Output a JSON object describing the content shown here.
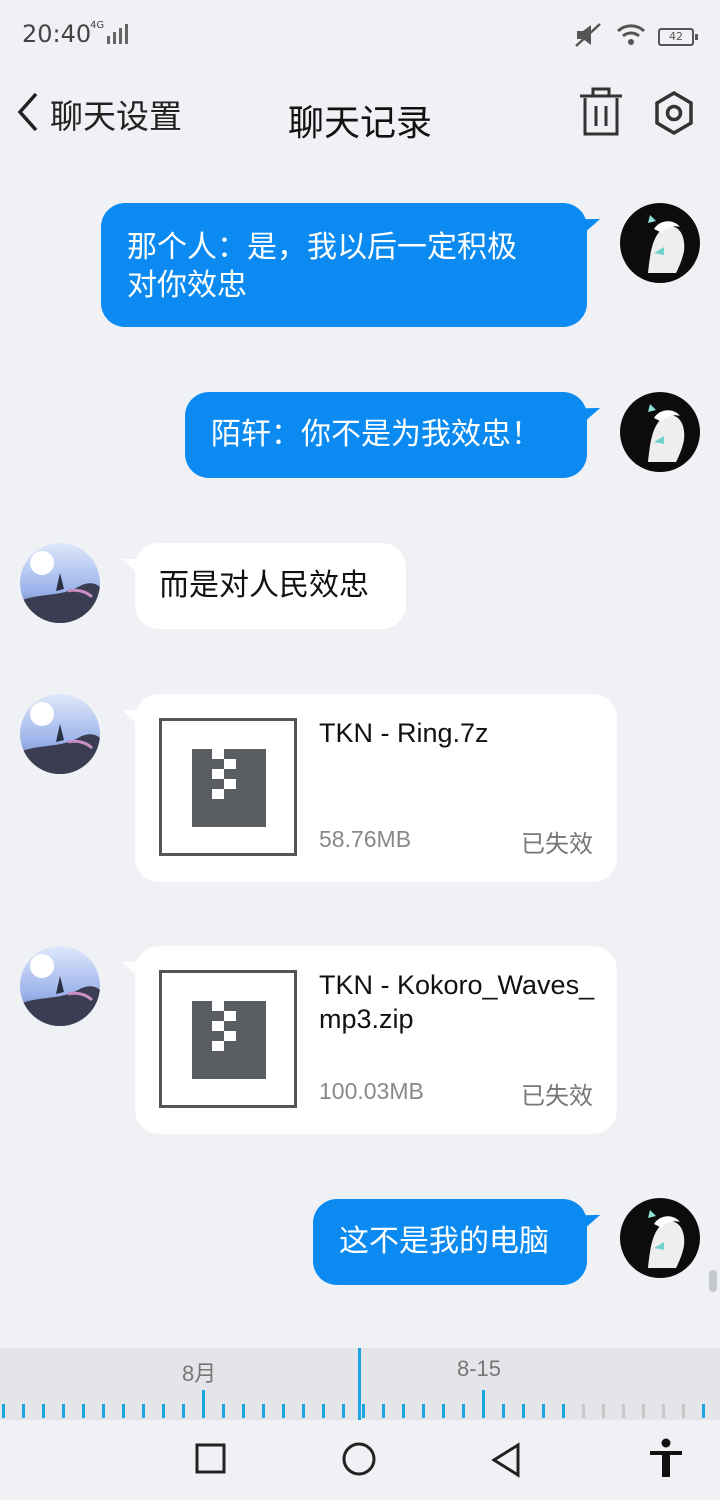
{
  "status": {
    "time": "20:40",
    "network": "4G",
    "battery": "42"
  },
  "header": {
    "back_label": "聊天设置",
    "title": "聊天记录"
  },
  "messages": [
    {
      "side": "right",
      "text": "那个人：是，我以后一定积极\n对你效忠"
    },
    {
      "side": "right",
      "text": "陌轩：你不是为我效忠！"
    },
    {
      "side": "left",
      "text": "而是对人民效忠"
    },
    {
      "side": "left",
      "type": "file",
      "name": "TKN - Ring.7z",
      "size": "58.76MB",
      "status": "已失效"
    },
    {
      "side": "left",
      "type": "file",
      "name": "TKN - Kokoro_Waves_mp3.zip",
      "size": "100.03MB",
      "status": "已失效"
    },
    {
      "side": "right",
      "text": "这不是我的电脑"
    }
  ],
  "timeline": {
    "label_month": "8月",
    "label_date": "8-15"
  },
  "colors": {
    "accent": "#0b8bf2",
    "timeline": "#1ba7e3",
    "background": "#eff1f4"
  },
  "icons": [
    "back-chevron-icon",
    "trash-icon",
    "settings-icon",
    "archive-file-icon",
    "square-nav-icon",
    "circle-nav-icon",
    "triangle-back-nav-icon",
    "accessibility-icon"
  ]
}
